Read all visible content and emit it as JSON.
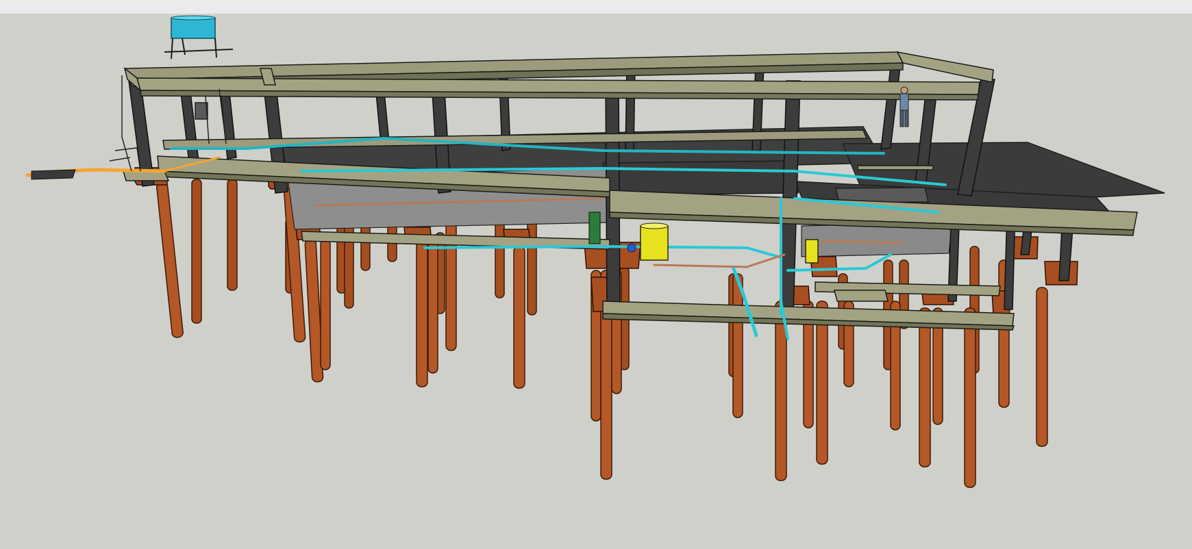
{
  "window": {
    "top_strip": ""
  },
  "viewport": {
    "label": "",
    "colors": {
      "background": "#d0d0cb",
      "beam_top": "#a3a383",
      "beam_side": "#7d7f62",
      "column": "#3b3b3b",
      "slab": "#3a3a3a",
      "slab_edge": "#2a2a2a",
      "basin_wall": "#8d8d8d",
      "pile": "#a54e20",
      "pile_light": "#c0622c",
      "pile_cap": "#a84f22",
      "pipe_water": "#2bc8d6",
      "pipe_copper": "#b87a55",
      "pipe_orange": "#f3a531",
      "tank_top": "#2fb6d4",
      "yellow_tank": "#e6e21f",
      "pump_green": "#2d7a3a"
    },
    "objects": [
      {
        "name": "roof-water-tank",
        "icon": "water-tank-icon"
      },
      {
        "name": "yellow-tank-left",
        "icon": "cylinder-tank-icon"
      },
      {
        "name": "yellow-tank-right",
        "icon": "cylinder-tank-icon"
      },
      {
        "name": "pump-unit",
        "icon": "pump-icon"
      },
      {
        "name": "human-figure",
        "icon": "person-scale-icon"
      },
      {
        "name": "orange-inlet-pipe",
        "icon": "pipe-icon"
      }
    ]
  }
}
